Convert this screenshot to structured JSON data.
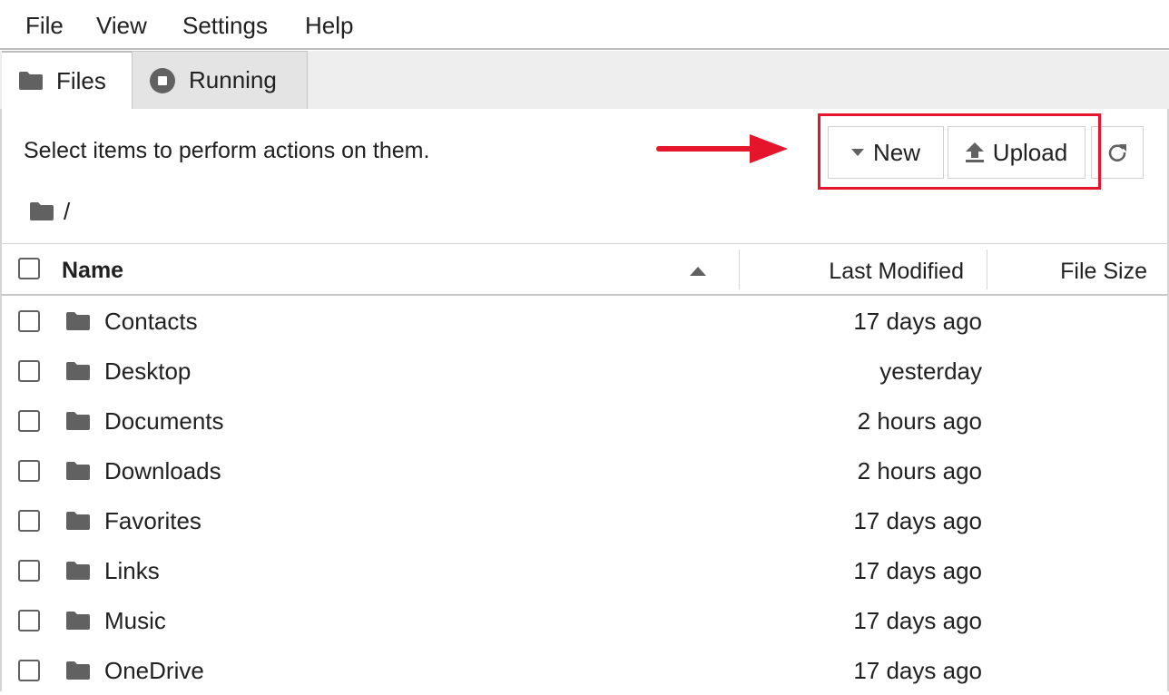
{
  "menubar": {
    "items": [
      {
        "label": "File"
      },
      {
        "label": "View"
      },
      {
        "label": "Settings"
      },
      {
        "label": "Help"
      }
    ]
  },
  "tabs": [
    {
      "label": "Files",
      "icon": "folder-icon"
    },
    {
      "label": "Running",
      "icon": "stop-circle-icon"
    }
  ],
  "toolbar": {
    "info_text": "Select items to perform actions on them.",
    "new_label": "New",
    "upload_label": "Upload",
    "refresh_icon": "refresh-icon"
  },
  "annotation": {
    "arrow_color": "#e5152b",
    "box_color": "#e5152b"
  },
  "breadcrumb": {
    "icon": "folder-icon",
    "path": "/"
  },
  "list": {
    "headers": {
      "name": "Name",
      "modified": "Last Modified",
      "size": "File Size"
    },
    "rows": [
      {
        "name": "Contacts",
        "modified": "17 days ago"
      },
      {
        "name": "Desktop",
        "modified": "yesterday"
      },
      {
        "name": "Documents",
        "modified": "2 hours ago"
      },
      {
        "name": "Downloads",
        "modified": "2 hours ago"
      },
      {
        "name": "Favorites",
        "modified": "17 days ago"
      },
      {
        "name": "Links",
        "modified": "17 days ago"
      },
      {
        "name": "Music",
        "modified": "17 days ago"
      },
      {
        "name": "OneDrive",
        "modified": "17 days ago"
      }
    ]
  }
}
